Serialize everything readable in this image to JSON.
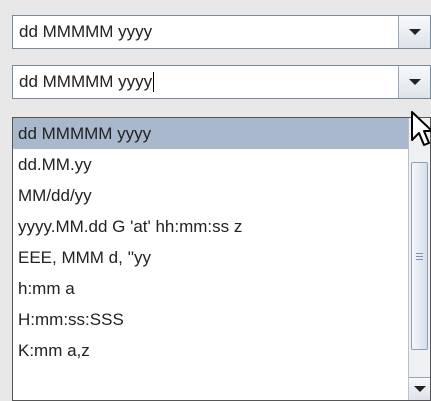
{
  "combo_top": {
    "value": "dd MMMMM yyyy"
  },
  "combo_editing": {
    "value": "dd MMMMM yyyy"
  },
  "dropdown": {
    "items": [
      "dd MMMMM yyyy",
      "dd.MM.yy",
      "MM/dd/yy",
      "yyyy.MM.dd G 'at' hh:mm:ss z",
      "EEE, MMM d, ''yy",
      "h:mm a",
      "H:mm:ss:SSS",
      "K:mm a,z"
    ],
    "selected_index": 0
  },
  "colors": {
    "selection": "#a9b8cc",
    "border": "#7a8a99",
    "background": "#e8e8e8"
  },
  "icons": {
    "dropdown_arrow": "triangle-down",
    "cursor": "arrow-pointer"
  }
}
